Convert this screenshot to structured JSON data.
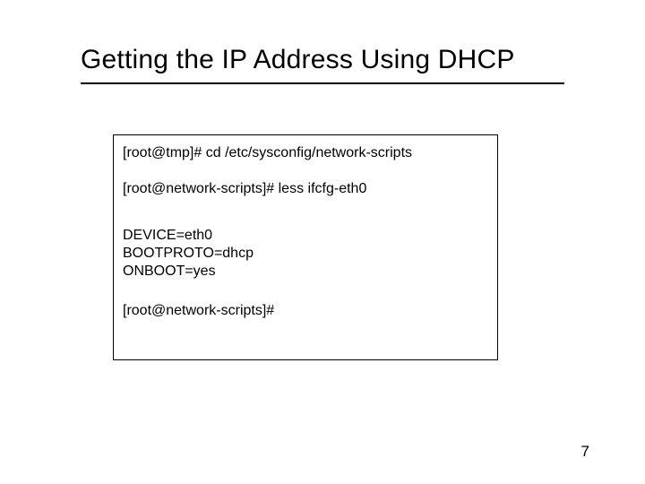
{
  "title": "Getting the IP Address Using DHCP",
  "terminal": {
    "line1": "[root@tmp]# cd /etc/sysconfig/network-scripts",
    "line2": "[root@network-scripts]# less ifcfg-eth0",
    "cfg1": "DEVICE=eth0",
    "cfg2": "BOOTPROTO=dhcp",
    "cfg3": "ONBOOT=yes",
    "line3": "[root@network-scripts]#"
  },
  "page_number": "7"
}
